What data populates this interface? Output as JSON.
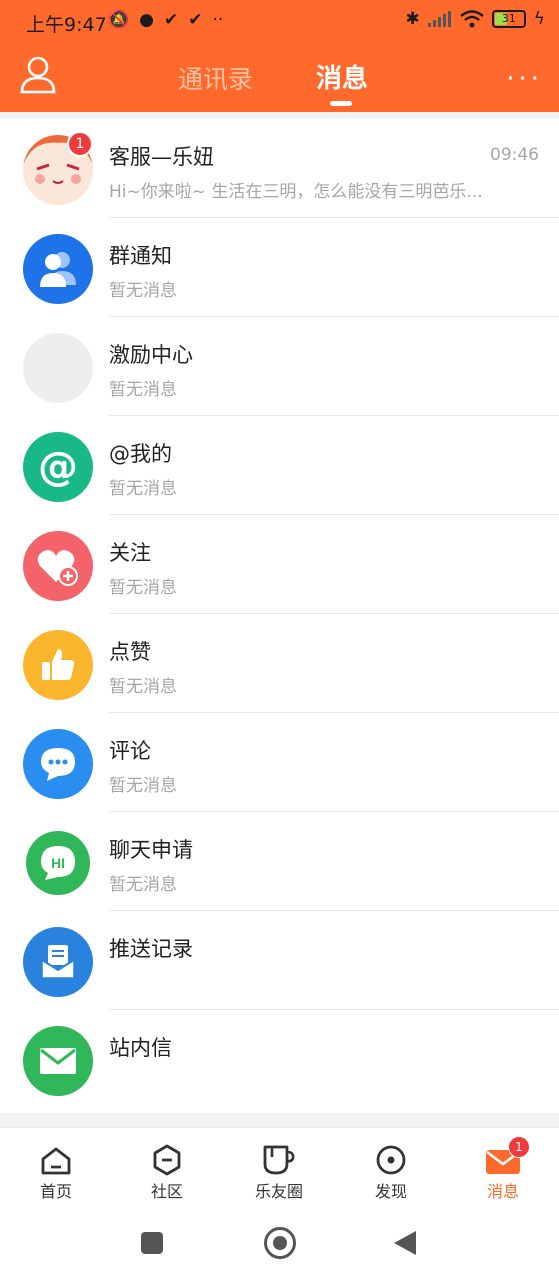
{
  "status_bar": {
    "time": "上午9:47",
    "battery": "31"
  },
  "header": {
    "tab_contacts": "通讯录",
    "tab_messages": "消息",
    "more": "···",
    "accent_color": "#ff6a2c"
  },
  "list": {
    "items": [
      {
        "title": "客服—乐妞",
        "subtitle": "Hi~你来啦~ 生活在三明，怎么能没有三明芭乐...",
        "time": "09:46",
        "badge": "1",
        "icon": "lenu-avatar-icon"
      },
      {
        "title": "群通知",
        "subtitle": "暂无消息",
        "icon": "group-icon"
      },
      {
        "title": "激励中心",
        "subtitle": "暂无消息",
        "icon": "placeholder-icon"
      },
      {
        "title": "@我的",
        "subtitle": "暂无消息",
        "icon": "at-icon"
      },
      {
        "title": "关注",
        "subtitle": "暂无消息",
        "icon": "heart-plus-icon"
      },
      {
        "title": "点赞",
        "subtitle": "暂无消息",
        "icon": "thumbs-up-icon"
      },
      {
        "title": "评论",
        "subtitle": "暂无消息",
        "icon": "comment-icon"
      },
      {
        "title": "聊天申请",
        "subtitle": "暂无消息",
        "icon": "chat-hi-icon"
      },
      {
        "title": "推送记录",
        "subtitle": "",
        "icon": "push-inbox-icon"
      },
      {
        "title": "站内信",
        "subtitle": "",
        "icon": "mail-icon"
      }
    ]
  },
  "bottom_nav": {
    "items": [
      {
        "label": "首页",
        "icon": "home-icon"
      },
      {
        "label": "社区",
        "icon": "community-icon"
      },
      {
        "label": "乐友圈",
        "icon": "cup-icon"
      },
      {
        "label": "发现",
        "icon": "discover-icon"
      },
      {
        "label": "消息",
        "icon": "message-icon",
        "badge": "1",
        "active": true
      }
    ]
  }
}
